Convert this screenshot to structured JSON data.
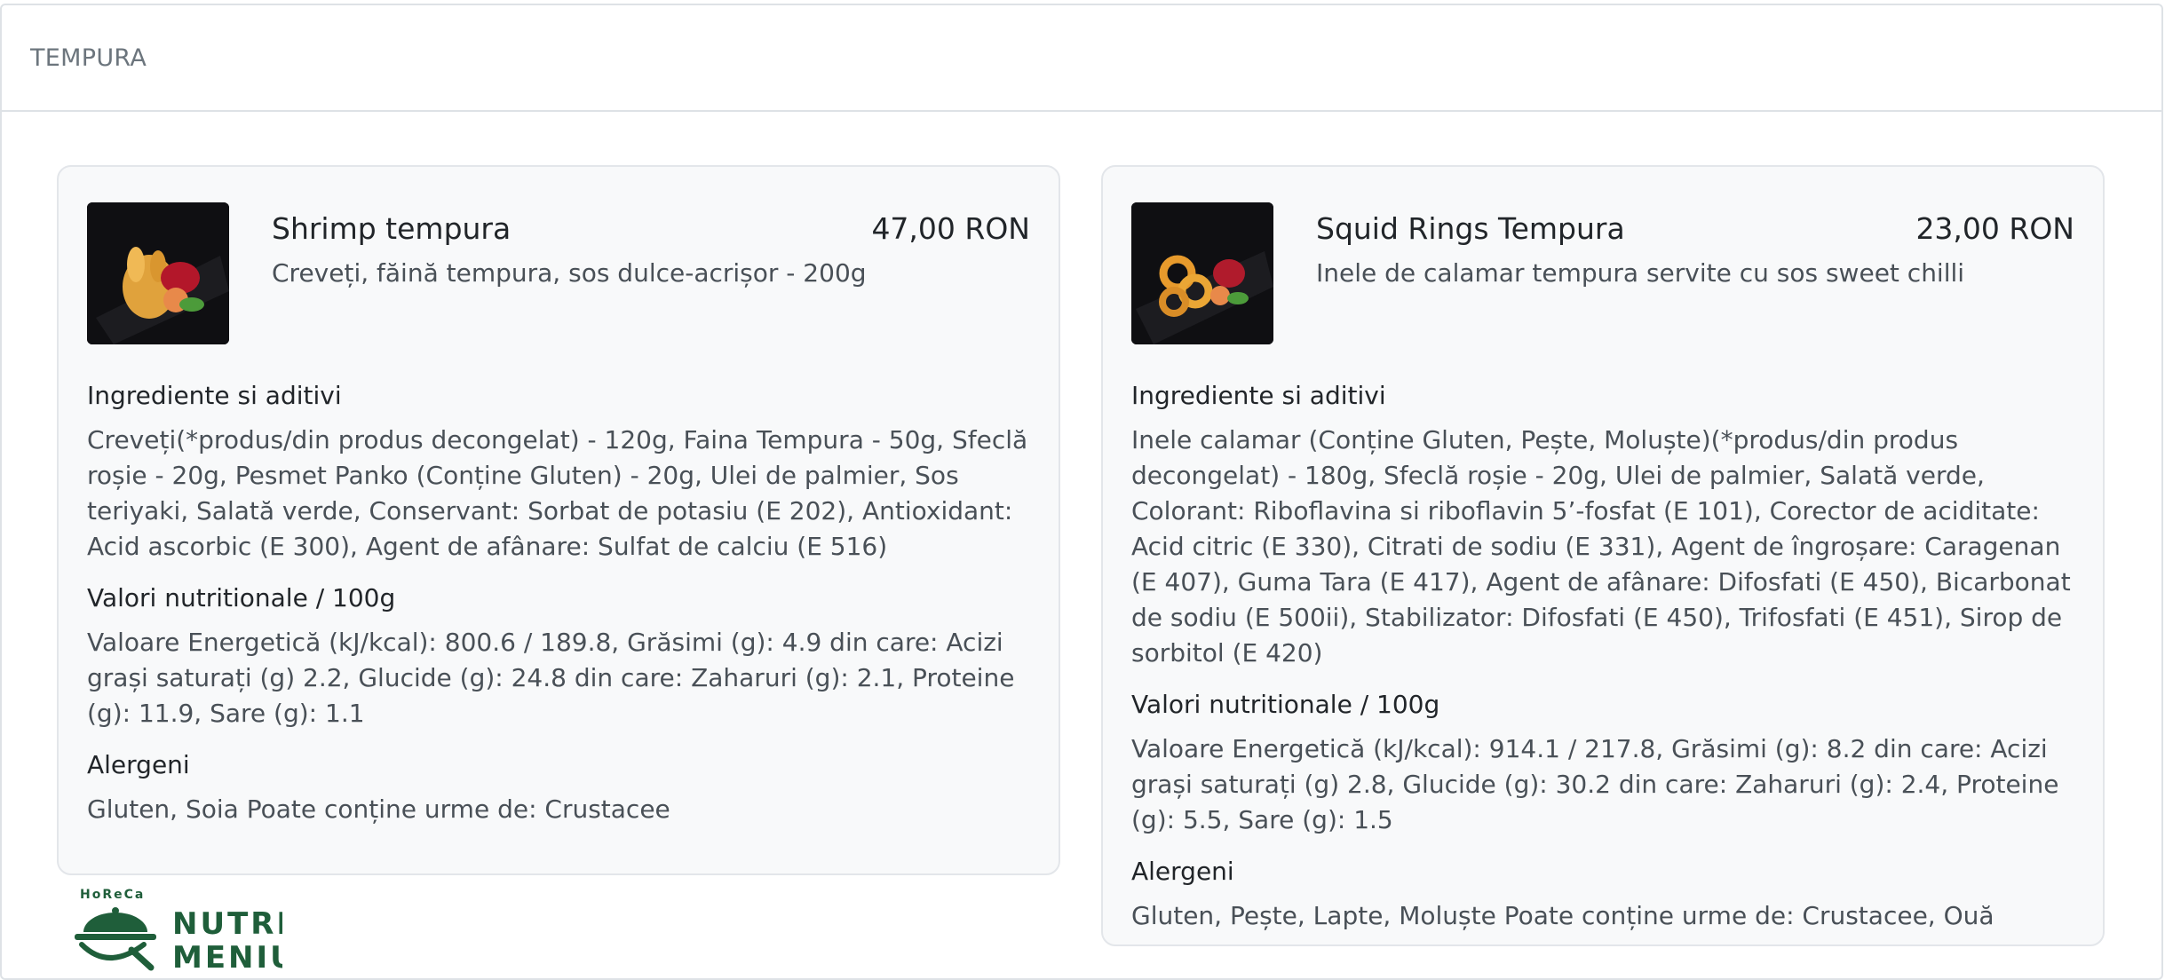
{
  "section": {
    "title": "TEMPURA"
  },
  "items": [
    {
      "name": "Shrimp tempura",
      "price": "47,00 RON",
      "description": "Creveți, făină tempura, sos dulce-acrișor - 200g",
      "ingredients_heading": "Ingrediente si aditivi",
      "ingredients": "Creveți(*produs/din produs decongelat) - 120g, Faina Tempura - 50g, Sfeclă roșie - 20g, Pesmet Panko (Conține Gluten) - 20g, Ulei de palmier, Sos teriyaki, Salată verde, Conservant: Sorbat de potasiu (E 202), Antioxidant: Acid ascorbic (E 300), Agent de afânare: Sulfat de calciu (E 516)",
      "nutrition_heading": "Valori nutritionale / 100g",
      "nutrition": "Valoare Energetică (kJ/kcal): 800.6 / 189.8, Grăsimi (g): 4.9 din care: Acizi grași saturați (g) 2.2, Glucide (g): 24.8 din care: Zaharuri (g): 2.1, Proteine (g): 11.9, Sare (g): 1.1",
      "allergens_heading": "Alergeni",
      "allergens": "Gluten, Soia Poate conține urme de: Crustacee"
    },
    {
      "name": "Squid Rings Tempura",
      "price": "23,00 RON",
      "description": "Inele de calamar tempura servite cu sos sweet chilli",
      "ingredients_heading": "Ingrediente si aditivi",
      "ingredients": "Inele calamar (Conține Gluten, Pește, Moluște)(*produs/din produs decongelat) - 180g, Sfeclă roșie - 20g, Ulei de palmier, Salată verde, Colorant: Riboflavina si riboflavin 5’-fosfat (E 101), Corector de aciditate: Acid citric (E 330), Citrati de sodiu (E 331), Agent de îngroșare: Caragenan (E 407), Guma Tara (E 417), Agent de afânare: Difosfati (E 450), Bicarbonat de sodiu (E 500ii), Stabilizator: Difosfati (E 450), Trifosfati (E 451), Sirop de sorbitol (E 420)",
      "nutrition_heading": "Valori nutritionale / 100g",
      "nutrition": "Valoare Energetică (kJ/kcal): 914.1 / 217.8, Grăsimi (g): 8.2 din care: Acizi grași saturați (g) 2.8, Glucide (g): 30.2 din care: Zaharuri (g): 2.4, Proteine (g): 5.5, Sare (g): 1.5",
      "allergens_heading": "Alergeni",
      "allergens": "Gluten, Pește, Lapte, Moluște Poate conține urme de: Crustacee, Ouă"
    }
  ],
  "logo": {
    "top": "HoReCa",
    "line1": "NUTRI",
    "line2": "MENIU",
    "color": "#1f5e3a"
  }
}
